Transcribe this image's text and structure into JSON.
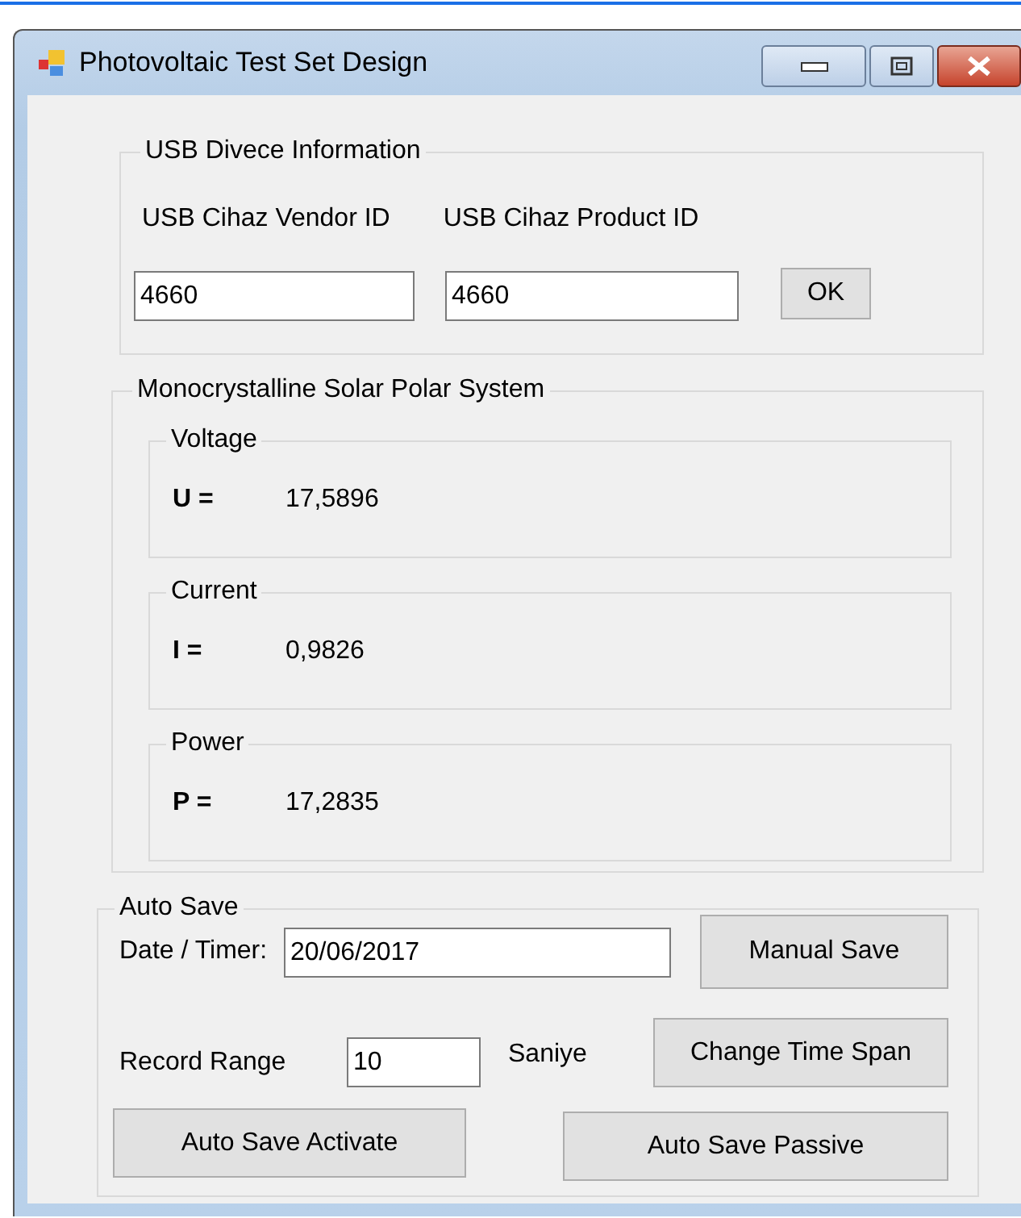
{
  "window": {
    "title": "Photovoltaic Test Set Design"
  },
  "usb_group": {
    "title": "USB Divece Information",
    "vendor_label": "USB Cihaz Vendor ID",
    "product_label": "USB Cihaz Product ID",
    "vendor_value": "4660",
    "product_value": "4660",
    "ok_button": "OK"
  },
  "solar_group": {
    "title": "Monocrystalline Solar Polar System",
    "measurements": [
      {
        "title": "Voltage",
        "symbol": "U =",
        "value": "17,5896"
      },
      {
        "title": "Current",
        "symbol": "I =",
        "value": "0,9826"
      },
      {
        "title": "Power",
        "symbol": "P =",
        "value": "17,2835"
      }
    ]
  },
  "auto_save": {
    "title": "Auto Save",
    "date_label": "Date / Timer:",
    "date_value": "20/06/2017",
    "manual_save_button": "Manual Save",
    "record_range_label": "Record Range",
    "record_range_value": "10",
    "unit": "Saniye",
    "change_time_span_button": "Change Time Span",
    "activate_button": "Auto Save Activate",
    "passive_button": "Auto Save Passive"
  }
}
